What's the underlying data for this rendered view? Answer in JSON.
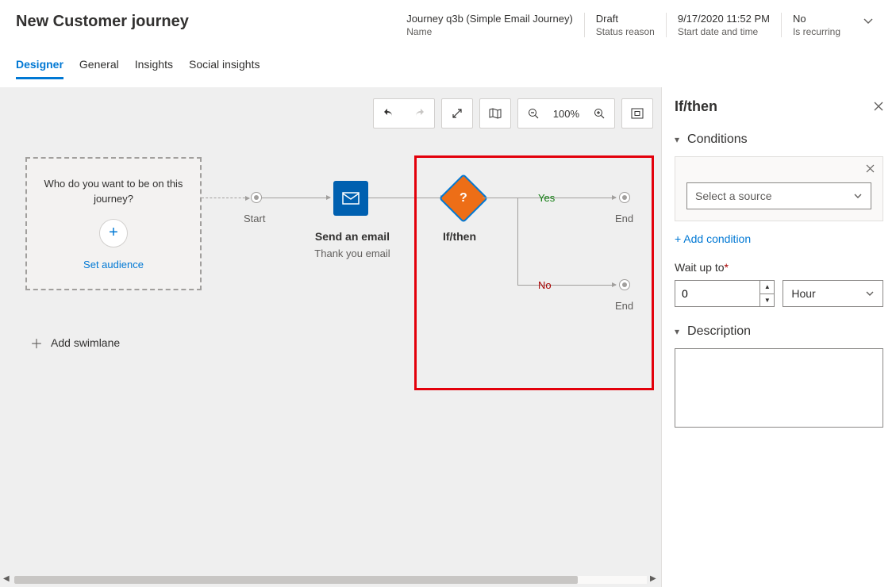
{
  "header": {
    "title": "New Customer journey",
    "fields": [
      {
        "value": "Journey q3b (Simple Email Journey)",
        "label": "Name"
      },
      {
        "value": "Draft",
        "label": "Status reason"
      },
      {
        "value": "9/17/2020 11:52 PM",
        "label": "Start date and time"
      },
      {
        "value": "No",
        "label": "Is recurring"
      }
    ]
  },
  "tabs": [
    "Designer",
    "General",
    "Insights",
    "Social insights"
  ],
  "active_tab": "Designer",
  "toolbar": {
    "zoom": "100%"
  },
  "canvas": {
    "audience_prompt": "Who do you want to be on this journey?",
    "set_audience": "Set audience",
    "start_label": "Start",
    "email": {
      "title": "Send an email",
      "subtitle": "Thank you email"
    },
    "ifthen_label": "If/then",
    "yes": "Yes",
    "no": "No",
    "end": "End",
    "add_swimlane": "Add swimlane"
  },
  "panel": {
    "title": "If/then",
    "sections": {
      "conditions": "Conditions",
      "description": "Description"
    },
    "select_source_placeholder": "Select a source",
    "add_condition": "+ Add condition",
    "wait_label": "Wait up to",
    "wait_value": "0",
    "wait_unit": "Hour",
    "description_value": ""
  }
}
